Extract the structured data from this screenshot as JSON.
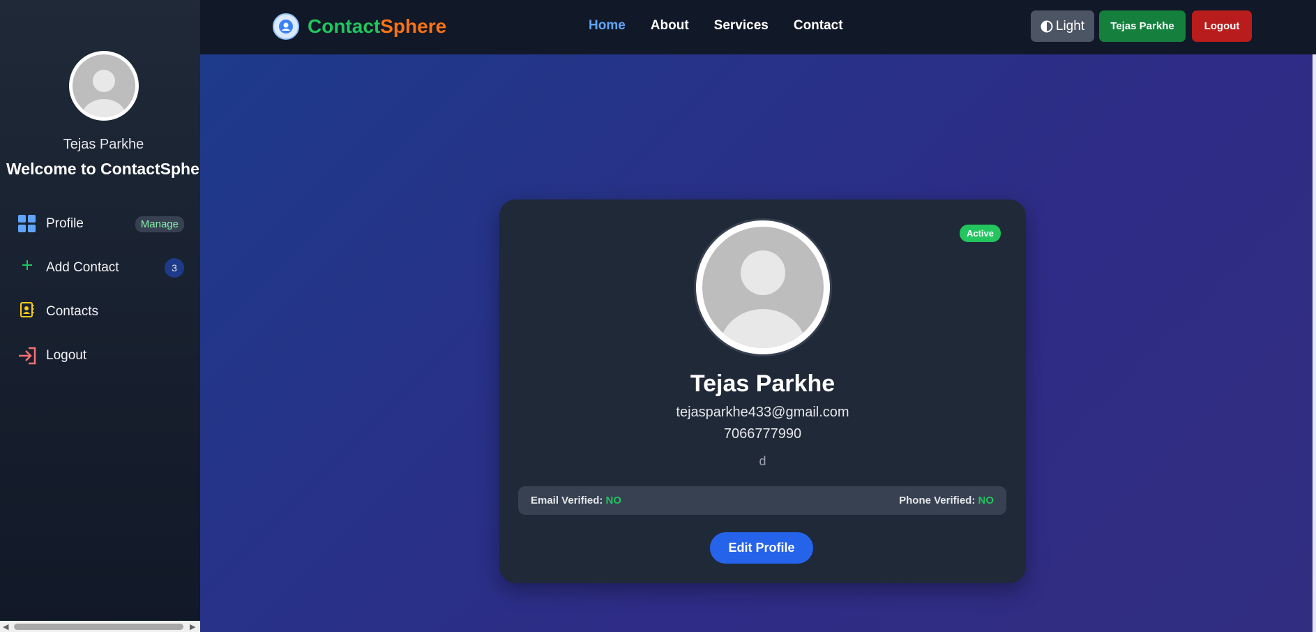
{
  "sidebar": {
    "user_name": "Tejas Parkhe",
    "welcome": "Welcome to ContactSphere",
    "items": [
      {
        "label": "Profile",
        "badge": "Manage"
      },
      {
        "label": "Add Contact",
        "badge": "3"
      },
      {
        "label": "Contacts"
      },
      {
        "label": "Logout"
      }
    ]
  },
  "header": {
    "brand_a": "Contact",
    "brand_b": "Sphere",
    "nav": [
      "Home",
      "About",
      "Services",
      "Contact"
    ],
    "theme_label": "Light",
    "user_button": "Tejas Parkhe",
    "logout_button": "Logout"
  },
  "profile": {
    "status": "Active",
    "name": "Tejas Parkhe",
    "email": "tejasparkhe433@gmail.com",
    "phone": "7066777990",
    "about": "d",
    "email_verified_label": "Email Verified:",
    "email_verified_value": "NO",
    "phone_verified_label": "Phone Verified:",
    "phone_verified_value": "NO",
    "edit_button": "Edit Profile"
  },
  "colors": {
    "brand_green": "#22c55e",
    "brand_orange": "#f97316",
    "primary": "#2563eb",
    "danger": "#b91c1c",
    "success": "#15803d"
  }
}
